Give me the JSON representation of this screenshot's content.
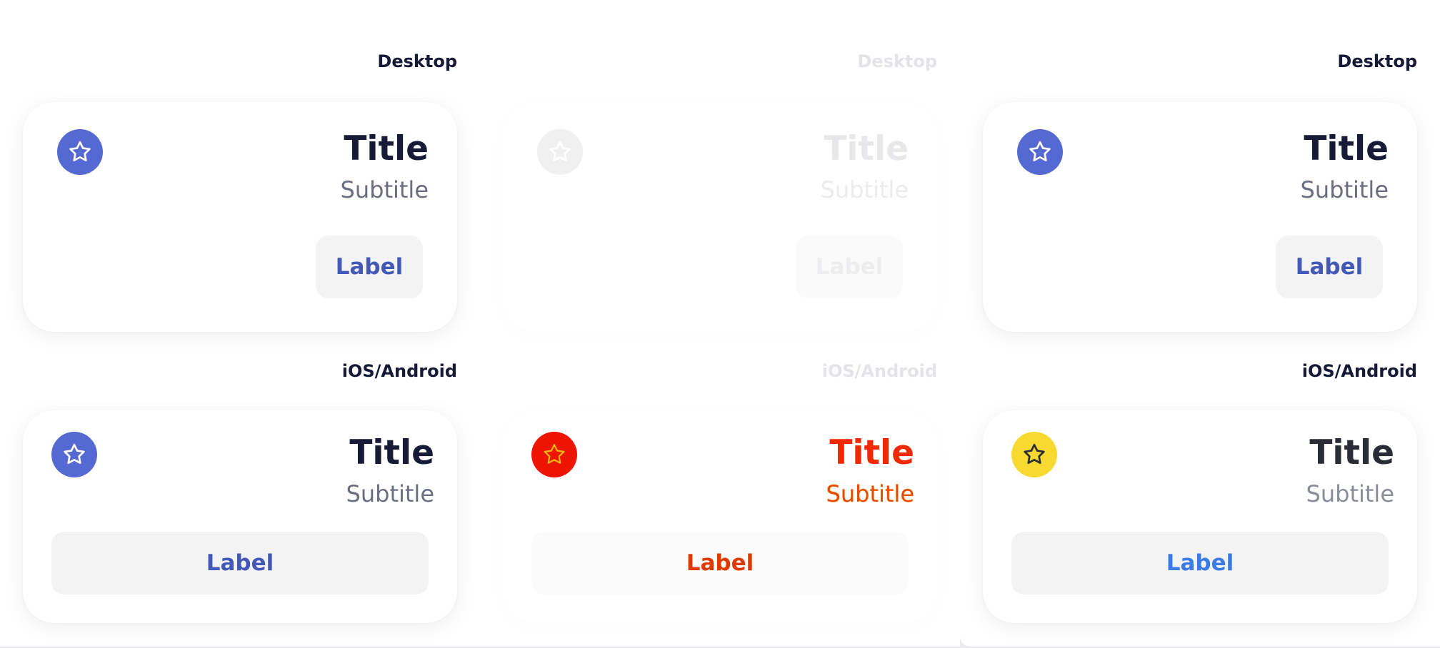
{
  "colors": {
    "accent": "#5569d3",
    "title": "#171b38",
    "subtitle": "#6b6e80",
    "button_bg": "#f3f3f4",
    "button_text": "#4458b8",
    "highlight_red": "#ee1500",
    "yellow_accent": "#f8d930",
    "blue_label_alt": "#3b7be6"
  },
  "panels": [
    {
      "desktop_label": "Desktop",
      "mobile_label": "iOS/Android",
      "desktop_card": {
        "icon": "star-icon",
        "title": "Title",
        "subtitle": "Subtitle",
        "button_label": "Label"
      },
      "mobile_card": {
        "icon": "star-icon",
        "title": "Title",
        "subtitle": "Subtitle",
        "button_label": "Label"
      }
    },
    {
      "desktop_label": "Desktop",
      "mobile_label": "iOS/Android",
      "desktop_card": {
        "icon": "star-icon",
        "title": "Title",
        "subtitle": "Subtitle",
        "button_label": "Label"
      },
      "mobile_card": {
        "icon": "star-icon",
        "title": "Title",
        "subtitle": "Subtitle",
        "button_label": "Label"
      }
    },
    {
      "desktop_label": "Desktop",
      "mobile_label": "iOS/Android",
      "desktop_card": {
        "icon": "star-icon",
        "title": "Title",
        "subtitle": "Subtitle",
        "button_label": "Label"
      },
      "mobile_card": {
        "icon": "star-icon",
        "title": "Title",
        "subtitle": "Subtitle",
        "button_label": "Label"
      }
    }
  ]
}
